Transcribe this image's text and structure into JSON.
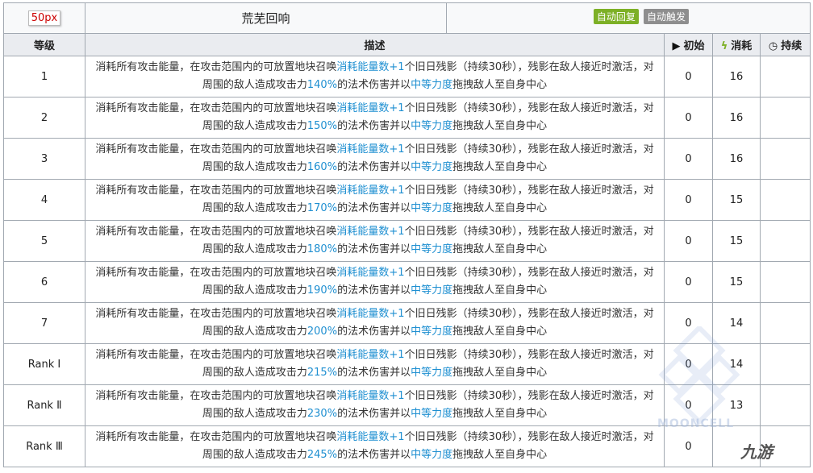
{
  "header": {
    "icon_placeholder": "50px",
    "skill_name": "荒芜回响",
    "tags": [
      "自动回复",
      "自动触发"
    ]
  },
  "columns": {
    "level": "等级",
    "description": "描述",
    "initial": "初始",
    "cost": "消耗",
    "duration": "持续"
  },
  "description_parts": {
    "a": "消耗所有攻击能量，在攻击范围内的可放置地块召唤",
    "b": "消耗能量数+1",
    "c": "个旧日残影（持续30秒），残影在敌人接近时激活，对周围的敌人造成攻击力",
    "d": "的法术伤害并以",
    "e": "中等力度",
    "f": "拖拽敌人至自身中心"
  },
  "rows": [
    {
      "level": "1",
      "pct": "140%",
      "initial": "0",
      "cost": "16",
      "duration": ""
    },
    {
      "level": "2",
      "pct": "150%",
      "initial": "0",
      "cost": "16",
      "duration": ""
    },
    {
      "level": "3",
      "pct": "160%",
      "initial": "0",
      "cost": "16",
      "duration": ""
    },
    {
      "level": "4",
      "pct": "170%",
      "initial": "0",
      "cost": "15",
      "duration": ""
    },
    {
      "level": "5",
      "pct": "180%",
      "initial": "0",
      "cost": "15",
      "duration": ""
    },
    {
      "level": "6",
      "pct": "190%",
      "initial": "0",
      "cost": "15",
      "duration": ""
    },
    {
      "level": "7",
      "pct": "200%",
      "initial": "0",
      "cost": "14",
      "duration": ""
    },
    {
      "level": "Rank Ⅰ",
      "pct": "215%",
      "initial": "0",
      "cost": "14",
      "duration": ""
    },
    {
      "level": "Rank Ⅱ",
      "pct": "230%",
      "initial": "0",
      "cost": "13",
      "duration": ""
    },
    {
      "level": "Rank Ⅲ",
      "pct": "245%",
      "initial": "0",
      "cost": "",
      "duration": ""
    }
  ],
  "watermark": {
    "text": "MOONCELL",
    "logo": "九游"
  },
  "colors": {
    "highlight": "#1e8fd1",
    "tag_green": "#7db026",
    "tag_gray": "#8e8e8e",
    "header_bg": "#eaecf0"
  },
  "icons": {
    "initial": "play-icon",
    "cost": "bolt-icon",
    "duration": "clock-icon"
  }
}
